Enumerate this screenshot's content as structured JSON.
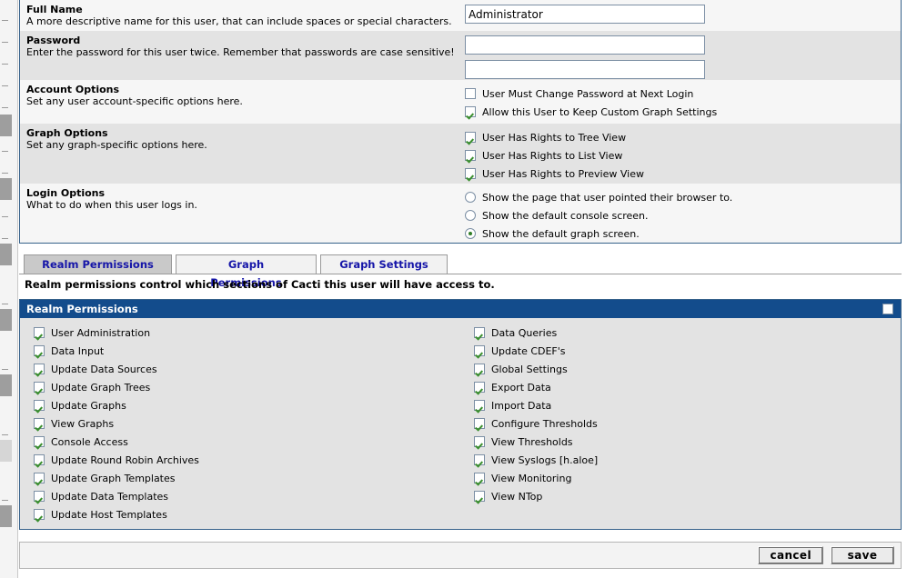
{
  "form": {
    "rows": [
      {
        "title": "Full Name",
        "desc": "A more descriptive name for this user, that can include spaces or special characters.",
        "type": "text",
        "value": "Administrator"
      },
      {
        "title": "Password",
        "desc": "Enter the password for this user twice. Remember that passwords are case sensitive!",
        "type": "password2",
        "value1": "",
        "value2": ""
      },
      {
        "title": "Account Options",
        "desc": "Set any user account-specific options here.",
        "type": "checks",
        "options": [
          {
            "label": "User Must Change Password at Next Login",
            "checked": false
          },
          {
            "label": "Allow this User to Keep Custom Graph Settings",
            "checked": true
          }
        ]
      },
      {
        "title": "Graph Options",
        "desc": "Set any graph-specific options here.",
        "type": "checks",
        "options": [
          {
            "label": "User Has Rights to Tree View",
            "checked": true
          },
          {
            "label": "User Has Rights to List View",
            "checked": true
          },
          {
            "label": "User Has Rights to Preview View",
            "checked": true
          }
        ]
      },
      {
        "title": "Login Options",
        "desc": "What to do when this user logs in.",
        "type": "radios",
        "options": [
          {
            "label": "Show the page that user pointed their browser to.",
            "checked": false
          },
          {
            "label": "Show the default console screen.",
            "checked": false
          },
          {
            "label": "Show the default graph screen.",
            "checked": true
          }
        ]
      }
    ]
  },
  "tabs": [
    {
      "label": "Realm Permissions",
      "active": true
    },
    {
      "label": "Graph Permissions",
      "active": false
    },
    {
      "label": "Graph Settings",
      "active": false
    }
  ],
  "tab_description": "Realm permissions control which sections of Cacti this user will have access to.",
  "permissions": {
    "header_title": "Realm Permissions",
    "header_checkbox_checked": false,
    "left_column": [
      {
        "label": "User Administration",
        "checked": true
      },
      {
        "label": "Data Input",
        "checked": true
      },
      {
        "label": "Update Data Sources",
        "checked": true
      },
      {
        "label": "Update Graph Trees",
        "checked": true
      },
      {
        "label": "Update Graphs",
        "checked": true
      },
      {
        "label": "View Graphs",
        "checked": true
      },
      {
        "label": "Console Access",
        "checked": true
      },
      {
        "label": "Update Round Robin Archives",
        "checked": true
      },
      {
        "label": "Update Graph Templates",
        "checked": true
      },
      {
        "label": "Update Data Templates",
        "checked": true
      },
      {
        "label": "Update Host Templates",
        "checked": true
      }
    ],
    "right_column": [
      {
        "label": "Data Queries",
        "checked": true
      },
      {
        "label": "Update CDEF's",
        "checked": true
      },
      {
        "label": "Global Settings",
        "checked": true
      },
      {
        "label": "Export Data",
        "checked": true
      },
      {
        "label": "Import Data",
        "checked": true
      },
      {
        "label": "Configure Thresholds",
        "checked": true
      },
      {
        "label": "View Thresholds",
        "checked": true
      },
      {
        "label": "View Syslogs [h.aloe]",
        "checked": true
      },
      {
        "label": "View Monitoring",
        "checked": true
      },
      {
        "label": "View NTop",
        "checked": true
      }
    ]
  },
  "actions": {
    "cancel_label": "cancel",
    "save_label": "save"
  },
  "colors": {
    "header_blue": "#134c8c",
    "panel_border": "#36618a",
    "tab_text": "#1515a8",
    "check_green": "#3a8f2e",
    "row_alt": "#e3e3e3",
    "row_plain": "#f6f6f6"
  }
}
